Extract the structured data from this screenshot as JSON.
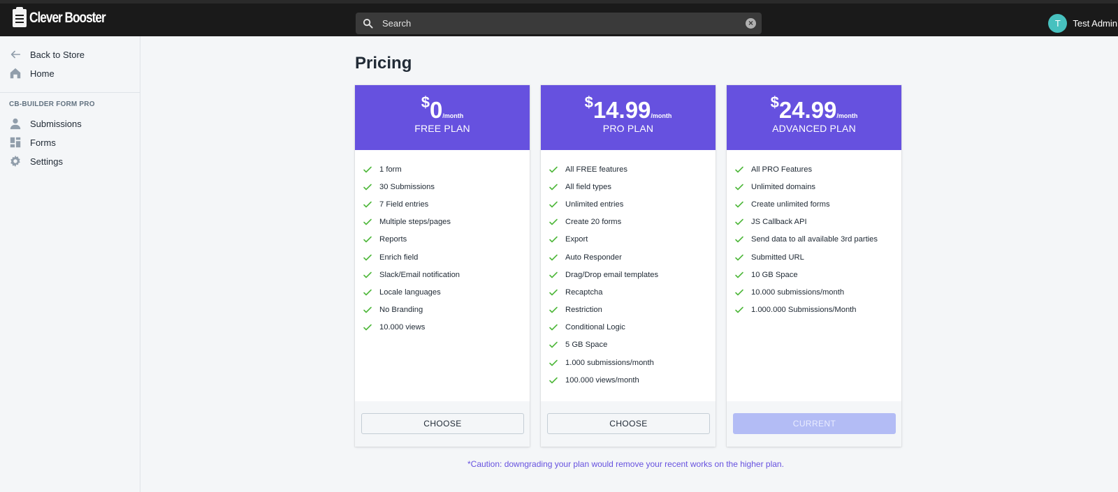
{
  "app": {
    "brand": "Clever Booster"
  },
  "search": {
    "placeholder": "Search",
    "icon": "search-icon",
    "clear_icon": "clear-icon"
  },
  "user": {
    "initial": "T",
    "name": "Test Admin",
    "avatar_color": "#47c1bf"
  },
  "sidebar": {
    "top_items": [
      {
        "label": "Back to Store",
        "icon": "arrow-left-icon"
      },
      {
        "label": "Home",
        "icon": "home-icon"
      }
    ],
    "section_title": "CB-BUILDER FORM PRO",
    "section_items": [
      {
        "label": "Submissions",
        "icon": "person-icon"
      },
      {
        "label": "Forms",
        "icon": "forms-icon"
      },
      {
        "label": "Settings",
        "icon": "gear-icon"
      }
    ]
  },
  "main": {
    "title": "Pricing",
    "accent_color": "#6651df",
    "plans": [
      {
        "currency": "$",
        "amount": "0",
        "period": "/month",
        "name": "FREE PLAN",
        "features": [
          "1 form",
          "30 Submissions",
          "7 Field entries",
          "Multiple steps/pages",
          "Reports",
          "Enrich field",
          "Slack/Email notification",
          "Locale languages",
          "No Branding",
          "10.000 views"
        ],
        "button": "CHOOSE"
      },
      {
        "currency": "$",
        "amount": "14.99",
        "period": "/month",
        "name": "PRO PLAN",
        "features": [
          "All FREE features",
          "All field types",
          "Unlimited entries",
          "Create 20 forms",
          "Export",
          "Auto Responder",
          "Drag/Drop email templates",
          "Recaptcha",
          "Restriction",
          "Conditional Logic",
          "5 GB Space",
          "1.000 submissions/month",
          "100.000 views/month"
        ],
        "button": "CHOOSE"
      },
      {
        "currency": "$",
        "amount": "24.99",
        "period": "/month",
        "name": "ADVANCED PLAN",
        "features": [
          "All PRO Features",
          "Unlimited domains",
          "Create unlimited forms",
          "JS Callback API",
          "Send data to all available 3rd parties",
          "Submitted URL",
          "10 GB Space",
          "10.000 submissions/month",
          "1.000.000 Submissions/Month"
        ],
        "button": "CURRENT"
      }
    ],
    "caution": "*Caution: downgrading your plan would remove your recent works on the higher plan."
  }
}
